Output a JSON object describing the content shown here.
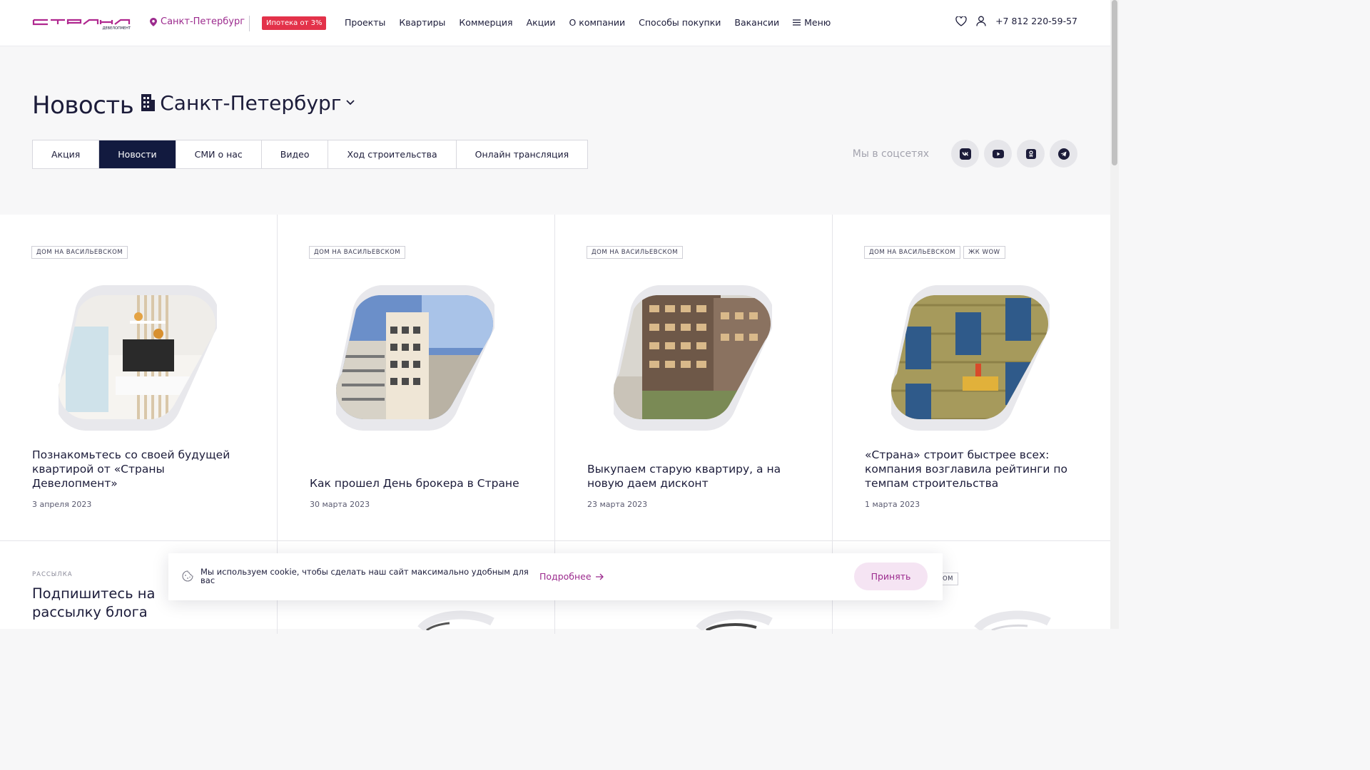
{
  "header": {
    "city": "Санкт-Петербург",
    "badge": "Ипотека от 3%",
    "nav": [
      "Проекты",
      "Квартиры",
      "Коммерция",
      "Акции",
      "О компании",
      "Способы покупки",
      "Вакансии"
    ],
    "menu_label": "Меню",
    "phone": "+7 812 220-59-57",
    "brand_color": "#9c2b8e",
    "badge_color": "#e3324a"
  },
  "page": {
    "title": "Новость",
    "city": "Санкт-Петербург"
  },
  "tabs": [
    "Акция",
    "Новости",
    "СМИ о нас",
    "Видео",
    "Ход строительства",
    "Онлайн трансляция"
  ],
  "active_tab": "Новости",
  "social": {
    "label": "Мы в соцсетях",
    "icons": [
      "vk-icon",
      "youtube-icon",
      "odnoklassniki-icon",
      "telegram-icon"
    ]
  },
  "cards": [
    {
      "tags": [
        "ДОМ НА ВАСИЛЬЕВСКОМ"
      ],
      "title": "Познакомьтесь со своей будущей квартирой от «Страны Девелопмент»",
      "date": "3 апреля 2023"
    },
    {
      "tags": [
        "ДОМ НА ВАСИЛЬЕВСКОМ"
      ],
      "title": "Как прошел День брокера в Стране",
      "date": "30 марта 2023"
    },
    {
      "tags": [
        "ДОМ НА ВАСИЛЬЕВСКОМ"
      ],
      "title": "Выкупаем старую квартиру, а на новую даем дисконт",
      "date": "23 марта 2023"
    },
    {
      "tags": [
        "ДОМ НА ВАСИЛЬЕВСКОМ",
        "ЖК WOW"
      ],
      "title": "«Страна» строит быстрее всех: компания возглавила рейтинги по темпам строительства",
      "date": "1 марта 2023"
    }
  ],
  "subscribe": {
    "label": "РАССЫЛКА",
    "title": "Подпишитесь на рассылку блога"
  },
  "row2_partial_tag": "СКОМ",
  "cookie": {
    "text": "Мы используем cookie, чтобы сделать наш сайт максимально удобным для вас",
    "more": "Подробнее",
    "accept": "Принять"
  }
}
